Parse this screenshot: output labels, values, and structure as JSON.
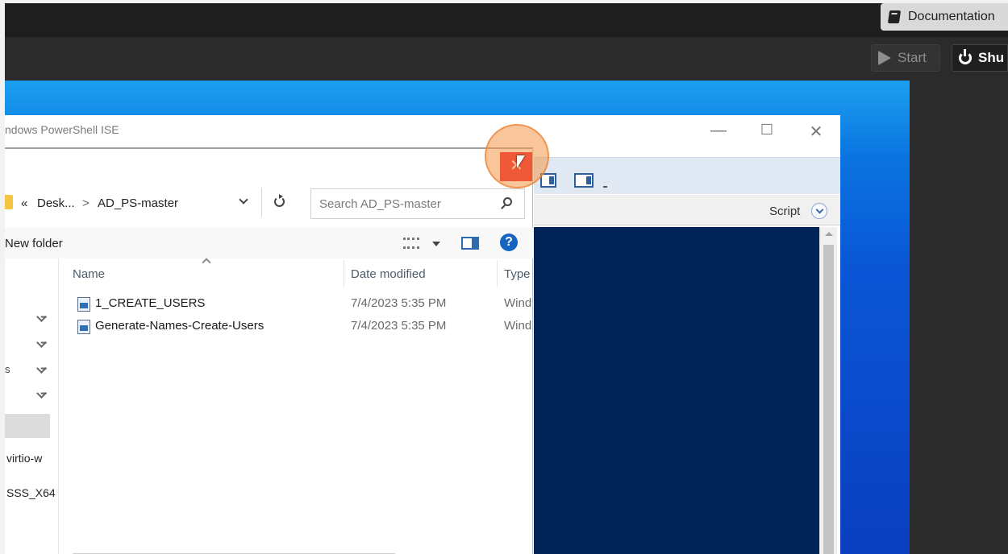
{
  "host": {
    "documentation_label": "Documentation",
    "start_label": "Start",
    "shutdown_label": "Shu"
  },
  "ise": {
    "title": "ndows PowerShell ISE",
    "script_label": "Script",
    "controls": {
      "minimize": "—",
      "maximize": "☐",
      "close": "✕"
    }
  },
  "dialog": {
    "breadcrumb": {
      "prefix": "«",
      "parent": "Desk...",
      "separator": ">",
      "current": "AD_PS-master"
    },
    "search_placeholder": "Search AD_PS-master",
    "new_folder_label": "New folder",
    "help_glyph": "?",
    "columns": {
      "name": "Name",
      "date_modified": "Date modified",
      "type": "Type"
    },
    "files": [
      {
        "name": "1_CREATE_USERS",
        "date": "7/4/2023 5:35 PM",
        "type": "Wind"
      },
      {
        "name": "Generate-Names-Create-Users",
        "date": "7/4/2023 5:35 PM",
        "type": "Wind"
      }
    ],
    "left_pane": {
      "mark": "s",
      "items": [
        "virtio-w",
        "SSS_X64"
      ]
    },
    "close_glyph": "✕"
  },
  "colors": {
    "close_red": "#e81123",
    "ise_script_pane": "#012456",
    "click_highlight": "#f49648",
    "desktop_blue": "#0a56d6"
  }
}
